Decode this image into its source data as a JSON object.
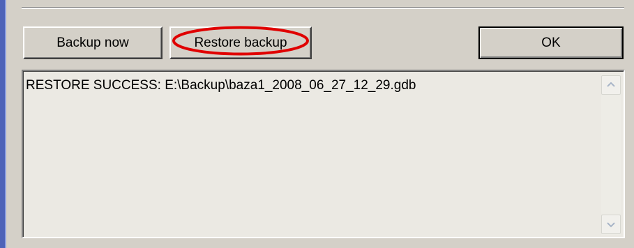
{
  "dialog": {
    "buttons": {
      "backup_now": "Backup now",
      "restore_backup": "Restore backup",
      "ok": "OK"
    },
    "log": {
      "lines": [
        "RESTORE SUCCESS: E:\\Backup\\baza1_2008_06_27_12_29.gdb"
      ]
    },
    "icons": {
      "scroll_up": "chevron-up-icon",
      "scroll_down": "chevron-down-icon"
    },
    "colors": {
      "window_bg": "#d4d0c8",
      "log_bg": "#ebe9e3",
      "highlight_ellipse": "#e00000",
      "left_border": "#4e63b8"
    }
  }
}
